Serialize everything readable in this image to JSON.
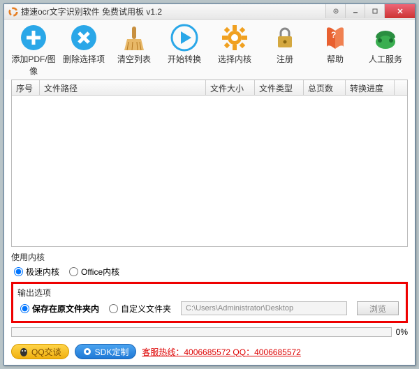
{
  "title": "捷速ocr文字识别软件 免费试用板 v1.2",
  "toolbar": [
    {
      "label": "添加PDF/图像",
      "name": "add-file"
    },
    {
      "label": "删除选择项",
      "name": "delete-item"
    },
    {
      "label": "清空列表",
      "name": "clear-list"
    },
    {
      "label": "开始转换",
      "name": "start-convert"
    },
    {
      "label": "选择内核",
      "name": "select-engine"
    },
    {
      "label": "注册",
      "name": "register"
    },
    {
      "label": "帮助",
      "name": "help"
    },
    {
      "label": "人工服务",
      "name": "support"
    }
  ],
  "columns": [
    "序号",
    "文件路径",
    "文件大小",
    "文件类型",
    "总页数",
    "转换进度"
  ],
  "engine": {
    "label": "使用内核",
    "opt1": "极速内核",
    "opt2": "Office内核"
  },
  "output": {
    "label": "输出选项",
    "opt1": "保存在原文件夹内",
    "opt2": "自定义文件夹",
    "path": "C:\\Users\\Administrator\\Desktop",
    "browse": "浏览"
  },
  "progress_pct": "0%",
  "qq_btn": "QQ交谈",
  "sdk_btn": "SDK定制",
  "hotline": "客服热线：4006685572 QQ：4006685572"
}
